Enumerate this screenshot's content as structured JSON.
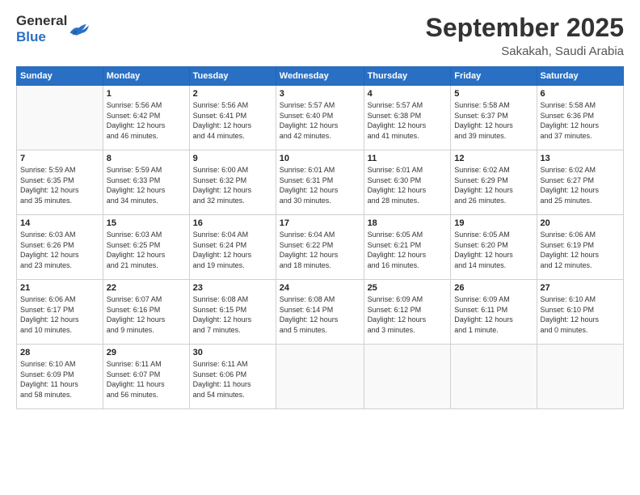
{
  "logo": {
    "line1": "General",
    "line2": "Blue"
  },
  "title": "September 2025",
  "location": "Sakakah, Saudi Arabia",
  "days_of_week": [
    "Sunday",
    "Monday",
    "Tuesday",
    "Wednesday",
    "Thursday",
    "Friday",
    "Saturday"
  ],
  "weeks": [
    [
      {
        "day": "",
        "info": ""
      },
      {
        "day": "1",
        "info": "Sunrise: 5:56 AM\nSunset: 6:42 PM\nDaylight: 12 hours\nand 46 minutes."
      },
      {
        "day": "2",
        "info": "Sunrise: 5:56 AM\nSunset: 6:41 PM\nDaylight: 12 hours\nand 44 minutes."
      },
      {
        "day": "3",
        "info": "Sunrise: 5:57 AM\nSunset: 6:40 PM\nDaylight: 12 hours\nand 42 minutes."
      },
      {
        "day": "4",
        "info": "Sunrise: 5:57 AM\nSunset: 6:38 PM\nDaylight: 12 hours\nand 41 minutes."
      },
      {
        "day": "5",
        "info": "Sunrise: 5:58 AM\nSunset: 6:37 PM\nDaylight: 12 hours\nand 39 minutes."
      },
      {
        "day": "6",
        "info": "Sunrise: 5:58 AM\nSunset: 6:36 PM\nDaylight: 12 hours\nand 37 minutes."
      }
    ],
    [
      {
        "day": "7",
        "info": "Sunrise: 5:59 AM\nSunset: 6:35 PM\nDaylight: 12 hours\nand 35 minutes."
      },
      {
        "day": "8",
        "info": "Sunrise: 5:59 AM\nSunset: 6:33 PM\nDaylight: 12 hours\nand 34 minutes."
      },
      {
        "day": "9",
        "info": "Sunrise: 6:00 AM\nSunset: 6:32 PM\nDaylight: 12 hours\nand 32 minutes."
      },
      {
        "day": "10",
        "info": "Sunrise: 6:01 AM\nSunset: 6:31 PM\nDaylight: 12 hours\nand 30 minutes."
      },
      {
        "day": "11",
        "info": "Sunrise: 6:01 AM\nSunset: 6:30 PM\nDaylight: 12 hours\nand 28 minutes."
      },
      {
        "day": "12",
        "info": "Sunrise: 6:02 AM\nSunset: 6:29 PM\nDaylight: 12 hours\nand 26 minutes."
      },
      {
        "day": "13",
        "info": "Sunrise: 6:02 AM\nSunset: 6:27 PM\nDaylight: 12 hours\nand 25 minutes."
      }
    ],
    [
      {
        "day": "14",
        "info": "Sunrise: 6:03 AM\nSunset: 6:26 PM\nDaylight: 12 hours\nand 23 minutes."
      },
      {
        "day": "15",
        "info": "Sunrise: 6:03 AM\nSunset: 6:25 PM\nDaylight: 12 hours\nand 21 minutes."
      },
      {
        "day": "16",
        "info": "Sunrise: 6:04 AM\nSunset: 6:24 PM\nDaylight: 12 hours\nand 19 minutes."
      },
      {
        "day": "17",
        "info": "Sunrise: 6:04 AM\nSunset: 6:22 PM\nDaylight: 12 hours\nand 18 minutes."
      },
      {
        "day": "18",
        "info": "Sunrise: 6:05 AM\nSunset: 6:21 PM\nDaylight: 12 hours\nand 16 minutes."
      },
      {
        "day": "19",
        "info": "Sunrise: 6:05 AM\nSunset: 6:20 PM\nDaylight: 12 hours\nand 14 minutes."
      },
      {
        "day": "20",
        "info": "Sunrise: 6:06 AM\nSunset: 6:19 PM\nDaylight: 12 hours\nand 12 minutes."
      }
    ],
    [
      {
        "day": "21",
        "info": "Sunrise: 6:06 AM\nSunset: 6:17 PM\nDaylight: 12 hours\nand 10 minutes."
      },
      {
        "day": "22",
        "info": "Sunrise: 6:07 AM\nSunset: 6:16 PM\nDaylight: 12 hours\nand 9 minutes."
      },
      {
        "day": "23",
        "info": "Sunrise: 6:08 AM\nSunset: 6:15 PM\nDaylight: 12 hours\nand 7 minutes."
      },
      {
        "day": "24",
        "info": "Sunrise: 6:08 AM\nSunset: 6:14 PM\nDaylight: 12 hours\nand 5 minutes."
      },
      {
        "day": "25",
        "info": "Sunrise: 6:09 AM\nSunset: 6:12 PM\nDaylight: 12 hours\nand 3 minutes."
      },
      {
        "day": "26",
        "info": "Sunrise: 6:09 AM\nSunset: 6:11 PM\nDaylight: 12 hours\nand 1 minute."
      },
      {
        "day": "27",
        "info": "Sunrise: 6:10 AM\nSunset: 6:10 PM\nDaylight: 12 hours\nand 0 minutes."
      }
    ],
    [
      {
        "day": "28",
        "info": "Sunrise: 6:10 AM\nSunset: 6:09 PM\nDaylight: 11 hours\nand 58 minutes."
      },
      {
        "day": "29",
        "info": "Sunrise: 6:11 AM\nSunset: 6:07 PM\nDaylight: 11 hours\nand 56 minutes."
      },
      {
        "day": "30",
        "info": "Sunrise: 6:11 AM\nSunset: 6:06 PM\nDaylight: 11 hours\nand 54 minutes."
      },
      {
        "day": "",
        "info": ""
      },
      {
        "day": "",
        "info": ""
      },
      {
        "day": "",
        "info": ""
      },
      {
        "day": "",
        "info": ""
      }
    ]
  ]
}
